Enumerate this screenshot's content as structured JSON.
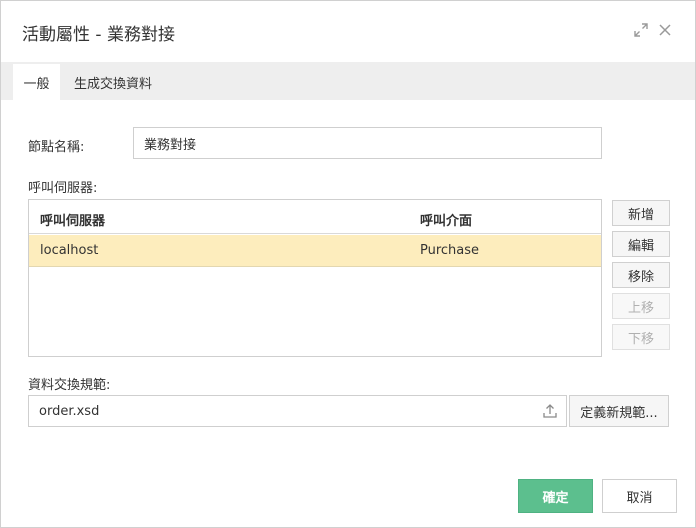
{
  "window": {
    "title": "活動屬性 - 業務對接"
  },
  "tabs": [
    {
      "label": "一般",
      "active": true
    },
    {
      "label": "生成交換資料",
      "active": false
    }
  ],
  "form": {
    "node_name_label": "節點名稱:",
    "node_name_value": "業務對接",
    "call_server_label": "呼叫伺服器:",
    "schema_label": "資料交換規範:",
    "schema_value": "order.xsd"
  },
  "server_table": {
    "columns": [
      "呼叫伺服器",
      "呼叫介面"
    ],
    "rows": [
      [
        "localhost",
        "Purchase"
      ]
    ]
  },
  "side_buttons": {
    "add": "新增",
    "edit": "編輯",
    "remove": "移除",
    "move_up": "上移",
    "move_down": "下移"
  },
  "define_button": "定義新規範...",
  "footer": {
    "ok": "確定",
    "cancel": "取消"
  },
  "colors": {
    "accent": "#5cbf8e",
    "selected_row": "#fdedbd"
  },
  "icons": {
    "maximize": "expand-icon",
    "close": "close-icon",
    "upload": "upload-icon"
  }
}
